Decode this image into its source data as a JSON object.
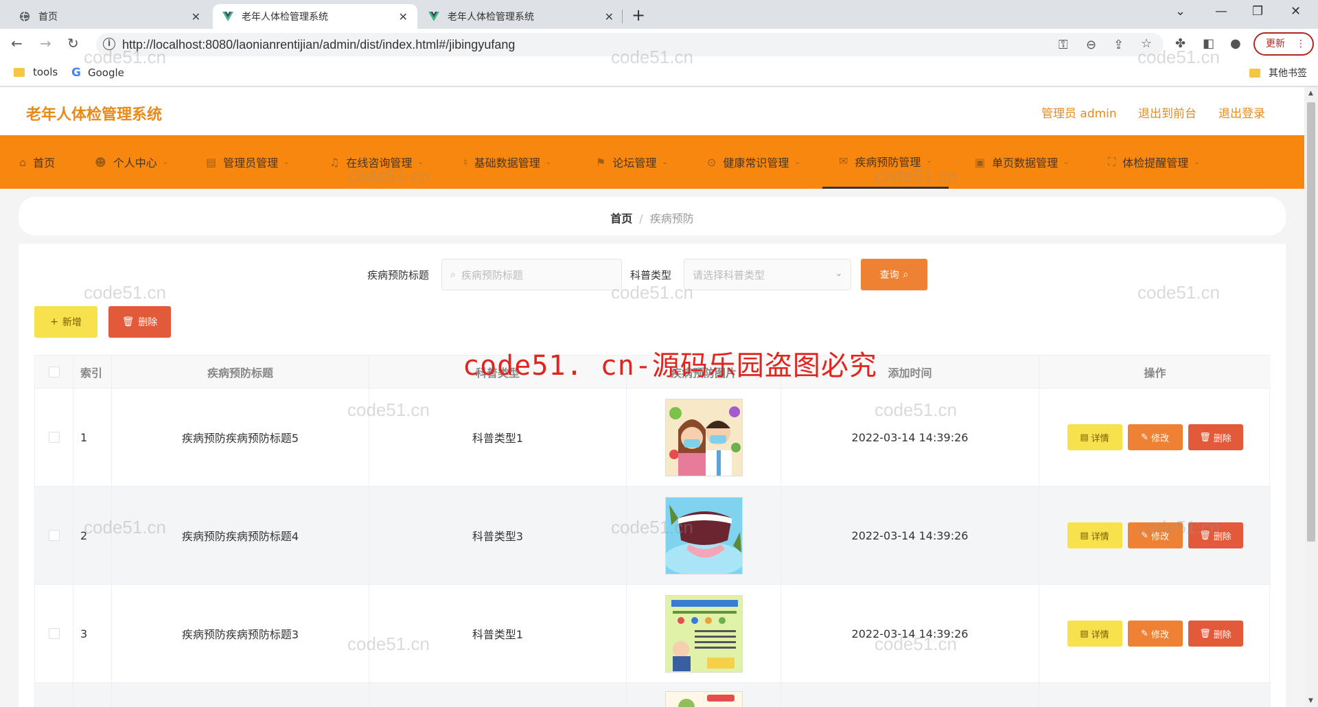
{
  "browser": {
    "tabs": [
      {
        "title": "首页",
        "icon": "globe-icon"
      },
      {
        "title": "老年人体检管理系统",
        "icon": "vue-logo-icon"
      },
      {
        "title": "老年人体检管理系统",
        "icon": "vue-logo-icon"
      }
    ],
    "url": "http://localhost:8080/laonianrentijian/admin/dist/index.html#/jibingyufang",
    "update_label": "更新",
    "bookmarks": [
      {
        "label": "tools",
        "icon": "folder-icon"
      },
      {
        "label": "Google",
        "icon": "google-icon"
      }
    ],
    "other_bookmarks": "其他书签"
  },
  "app": {
    "system_name": "老年人体检管理系统",
    "header_links": [
      "管理员 admin",
      "退出到前台",
      "退出登录"
    ],
    "accent": "#f7870e",
    "nav": [
      {
        "label": "首页",
        "icon": "home-icon"
      },
      {
        "label": "个人中心",
        "icon": "user-icon"
      },
      {
        "label": "管理员管理",
        "icon": "doc-icon"
      },
      {
        "label": "在线咨询管理",
        "icon": "bell-icon"
      },
      {
        "label": "基础数据管理",
        "icon": "mic-icon"
      },
      {
        "label": "论坛管理",
        "icon": "flag-icon"
      },
      {
        "label": "健康常识管理",
        "icon": "info-icon"
      },
      {
        "label": "疾病预防管理",
        "icon": "mail-icon"
      },
      {
        "label": "单页数据管理",
        "icon": "cube-icon"
      },
      {
        "label": "体检提醒管理",
        "icon": "expand-icon"
      }
    ],
    "breadcrumb": {
      "home": "首页",
      "current": "疾病预防"
    }
  },
  "search": {
    "title_label": "疾病预防标题",
    "title_placeholder": "疾病预防标题",
    "type_label": "科普类型",
    "type_placeholder": "请选择科普类型",
    "query_button": "查询"
  },
  "actions": {
    "add": "新增",
    "delete": "删除"
  },
  "table": {
    "headers": [
      "索引",
      "疾病预防标题",
      "科普类型",
      "疾病预防图片",
      "添加时间",
      "操作"
    ],
    "rows": [
      {
        "index": "1",
        "title": "疾病预防疾病预防标题5",
        "type": "科普类型1",
        "time": "2022-03-14 14:39:26"
      },
      {
        "index": "2",
        "title": "疾病预防疾病预防标题4",
        "type": "科普类型3",
        "time": "2022-03-14 14:39:26"
      },
      {
        "index": "3",
        "title": "疾病预防疾病预防标题3",
        "type": "科普类型1",
        "time": "2022-03-14 14:39:26"
      }
    ],
    "row_actions": {
      "detail": "详情",
      "edit": "修改",
      "delete": "删除"
    }
  },
  "watermarks": {
    "small": "code51.cn",
    "big": "code51. cn-源码乐园盗图必究"
  }
}
